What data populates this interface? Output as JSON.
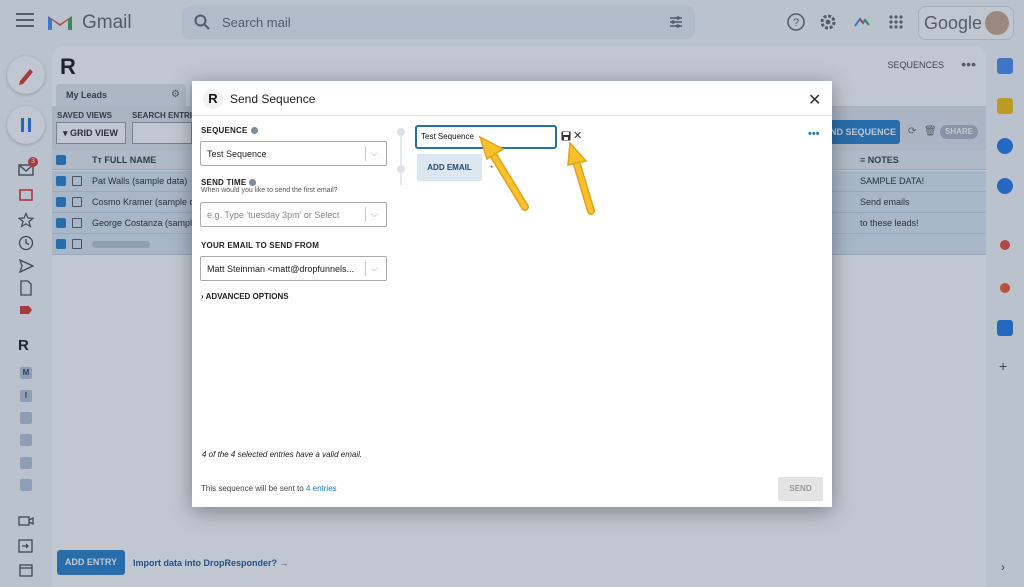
{
  "gmail": {
    "app_name": "Gmail",
    "search_placeholder": "Search mail",
    "google_label": "Google",
    "inbox_badge": "3"
  },
  "dropresponder": {
    "sequences_link": "SEQUENCES",
    "tab_label": "My Leads",
    "saved_views_label": "SAVED VIEWS",
    "search_entries_label": "SEARCH ENTRI",
    "grid_view_button": "GRID VIEW",
    "send_sequence_button": "ND SEQUENCE",
    "share_button": "SHARE",
    "columns": {
      "full_name": "FULL NAME",
      "notes": "NOTES"
    },
    "rows": [
      {
        "name": "Pat Walls (sample data)",
        "notes": "SAMPLE DATA!"
      },
      {
        "name": "Cosmo Kramer (sample data",
        "notes": "Send emails"
      },
      {
        "name": "George Costanza (sample",
        "notes": "to these leads!"
      }
    ],
    "add_entry_button": "ADD ENTRY",
    "import_link": "Import data into DropResponder? →"
  },
  "modal": {
    "title": "Send Sequence",
    "sequence_label": "SEQUENCE",
    "sequence_value": "Test Sequence",
    "send_time_label": "SEND TIME",
    "send_time_sub": "When would you like to send the first email?",
    "send_time_placeholder": "e.g. Type 'tuesday 3pm' or Select",
    "email_from_label": "YOUR EMAIL TO SEND FROM",
    "email_from_value": "Matt Steinman <matt@dropfunnels...",
    "advanced_options": "ADVANCED OPTIONS",
    "valid_note": "4 of the 4 selected entries have a valid email.",
    "sent_note_prefix": "This sequence will be sent to",
    "sent_note_link": "4 entries",
    "send_button": "SEND",
    "sequence_name_value": "Test Sequence",
    "add_email_button": "ADD EMAIL",
    "more_menu": "•••"
  },
  "colors": {
    "accent": "#1f7bc6",
    "arrow": "#f3b61f",
    "overlay": "rgba(60,80,110,0.32)"
  }
}
